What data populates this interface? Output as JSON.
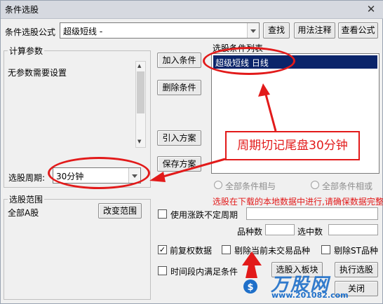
{
  "window": {
    "title": "条件选股",
    "close": "✕"
  },
  "formula_row": {
    "label": "条件选股公式",
    "value": "超级短线  -",
    "buttons": [
      "查找",
      "用法注释",
      "查看公式"
    ]
  },
  "params_group": {
    "label": "计算参数",
    "text": "无参数需要设置"
  },
  "period": {
    "label": "选股周期:",
    "value": "30分钟"
  },
  "condition_buttons": {
    "add": "加入条件",
    "delete": "删除条件",
    "import": "引入方案",
    "save": "保存方案"
  },
  "condition_list": {
    "label": "选股条件列表",
    "items": [
      "超级短线  日线"
    ]
  },
  "radios": {
    "and": "全部条件相与",
    "or": "全部条件相或"
  },
  "notice": "选股在下载的本地数据中进行,请确保数据完整",
  "range_group": {
    "label": "选股范围",
    "value": "全部A股",
    "button": "改变范围"
  },
  "options": {
    "unfixed_period": "使用涨跌不定周期",
    "count_label": "品种数",
    "selected_label": "选中数",
    "adjusted": "前复权数据",
    "exclude_no_trade": "剔除当前未交易品种",
    "exclude_st": "剔除ST品种",
    "time_range": "时间段内满足条件"
  },
  "bottom_buttons": {
    "to_block": "选股入板块",
    "run": "执行选股",
    "close": "关闭"
  },
  "annotation": {
    "callout": "周期切记尾盘30分钟"
  },
  "watermark": {
    "brand": "万股网",
    "url": "www.201082.com"
  },
  "colors": {
    "annotation_red": "#e21a1a",
    "selection_blue": "#0a246a"
  }
}
